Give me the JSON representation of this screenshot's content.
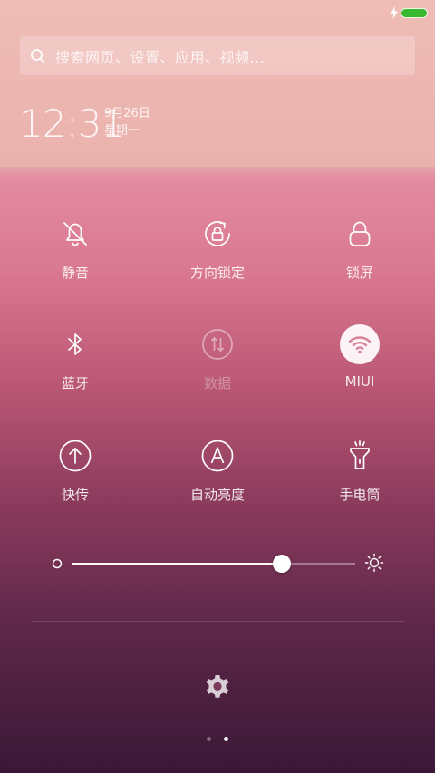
{
  "status_bar": {
    "battery_color": "#37b82e",
    "charging": true,
    "icons": [
      "charging-icon",
      "battery-icon"
    ]
  },
  "search": {
    "placeholder": "搜索网页、设置、应用、视频..."
  },
  "lockinfo": {
    "time": "12:31",
    "date": "9月26日",
    "weekday": "星期一"
  },
  "toggles": [
    {
      "label": "静音",
      "icon": "bell-off-icon",
      "state": "off"
    },
    {
      "label": "方向锁定",
      "icon": "rotation-lock-icon",
      "state": "off"
    },
    {
      "label": "锁屏",
      "icon": "lock-icon",
      "state": "off"
    },
    {
      "label": "蓝牙",
      "icon": "bluetooth-icon",
      "state": "off"
    },
    {
      "label": "数据",
      "icon": "mobile-data-icon",
      "state": "disabled"
    },
    {
      "label": "MIUI",
      "icon": "wifi-icon",
      "state": "on"
    },
    {
      "label": "快传",
      "icon": "quick-transfer-icon",
      "state": "off"
    },
    {
      "label": "自动亮度",
      "icon": "auto-brightness-icon",
      "state": "off"
    },
    {
      "label": "手电筒",
      "icon": "flashlight-icon",
      "state": "off"
    }
  ],
  "brightness": {
    "level": 0.74,
    "low_icon": "brightness-low-icon",
    "high_icon": "brightness-high-icon"
  },
  "footer": {
    "settings_icon": "gear-icon",
    "pages": 2,
    "current_page": 2
  }
}
